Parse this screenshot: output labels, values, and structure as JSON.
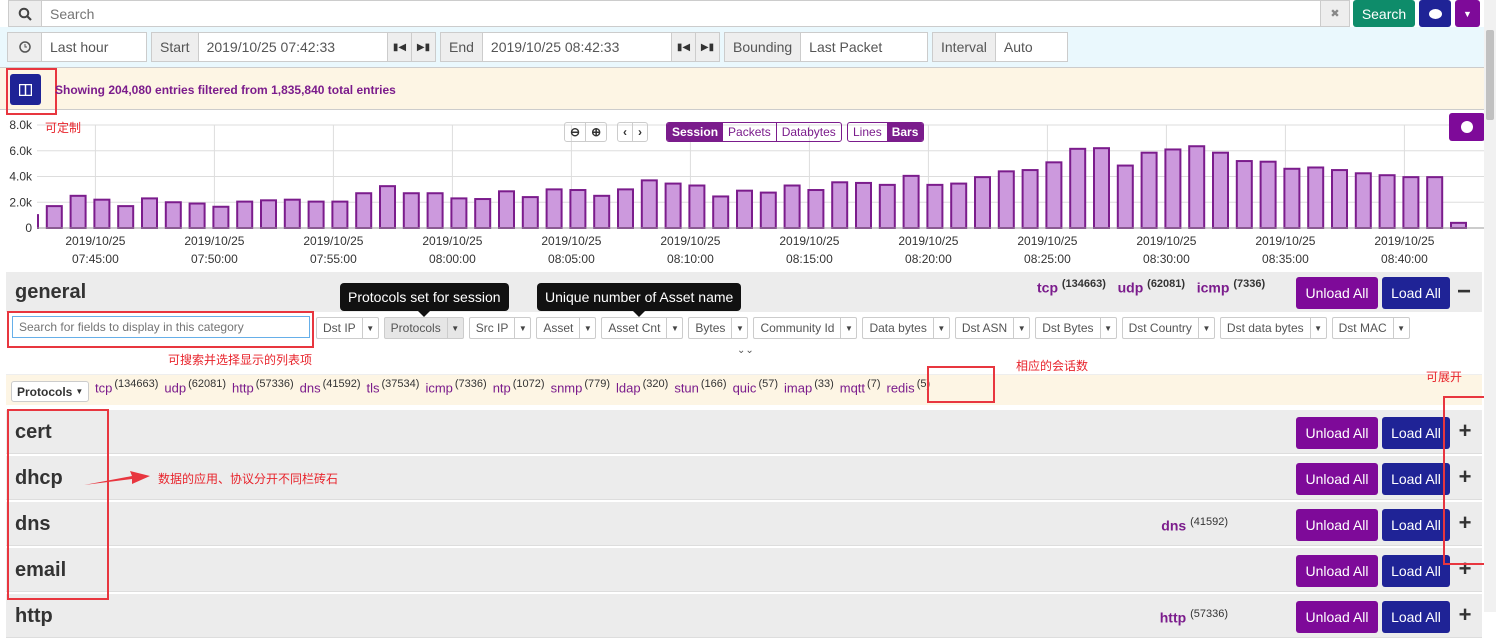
{
  "search": {
    "placeholder": "Search",
    "search_label": "Search",
    "clear": "✖"
  },
  "time": {
    "range": "Last hour",
    "start_label": "Start",
    "start": "2019/10/25 07:42:33",
    "end_label": "End",
    "end": "2019/10/25 08:42:33",
    "bounding_label": "Bounding",
    "bounding": "Last Packet",
    "interval_label": "Interval",
    "interval": "Auto"
  },
  "notice": "Showing 204,080 entries filtered from 1,835,840 total entries",
  "chart_controls": {
    "metrics": [
      "Session",
      "Packets",
      "Databytes"
    ],
    "active_metric": "Session",
    "styles": [
      "Lines",
      "Bars"
    ],
    "active_style": "Bars"
  },
  "colors": {
    "bar_fill": "#cc99dd",
    "bar_stroke": "#7b1c8c",
    "accent_purple": "#7e0a99",
    "navy": "#1f2396",
    "search_green": "#0e8c6a",
    "notice_bg": "#fdf5e4"
  },
  "chart_data": {
    "type": "bar",
    "title": "",
    "xlabel": "",
    "ylabel": "",
    "ylim": [
      0,
      8000
    ],
    "yticks": [
      "0",
      "2.0k",
      "4.0k",
      "6.0k",
      "8.0k"
    ],
    "xticks": [
      {
        "date": "2019/10/25",
        "time": "07:45:00"
      },
      {
        "date": "2019/10/25",
        "time": "07:50:00"
      },
      {
        "date": "2019/10/25",
        "time": "07:55:00"
      },
      {
        "date": "2019/10/25",
        "time": "08:00:00"
      },
      {
        "date": "2019/10/25",
        "time": "08:05:00"
      },
      {
        "date": "2019/10/25",
        "time": "08:10:00"
      },
      {
        "date": "2019/10/25",
        "time": "08:15:00"
      },
      {
        "date": "2019/10/25",
        "time": "08:20:00"
      },
      {
        "date": "2019/10/25",
        "time": "08:25:00"
      },
      {
        "date": "2019/10/25",
        "time": "08:30:00"
      },
      {
        "date": "2019/10/25",
        "time": "08:35:00"
      },
      {
        "date": "2019/10/25",
        "time": "08:40:00"
      }
    ],
    "grid": true,
    "categories": [
      "07:42",
      "07:43",
      "07:44",
      "07:45",
      "07:46",
      "07:47",
      "07:48",
      "07:49",
      "07:50",
      "07:51",
      "07:52",
      "07:53",
      "07:54",
      "07:55",
      "07:56",
      "07:57",
      "07:58",
      "07:59",
      "08:00",
      "08:01",
      "08:02",
      "08:03",
      "08:04",
      "08:05",
      "08:06",
      "08:07",
      "08:08",
      "08:09",
      "08:10",
      "08:11",
      "08:12",
      "08:13",
      "08:14",
      "08:15",
      "08:16",
      "08:17",
      "08:18",
      "08:19",
      "08:20",
      "08:21",
      "08:22",
      "08:23",
      "08:24",
      "08:25",
      "08:26",
      "08:27",
      "08:28",
      "08:29",
      "08:30",
      "08:31",
      "08:32",
      "08:33",
      "08:34",
      "08:35",
      "08:36",
      "08:37",
      "08:38",
      "08:39",
      "08:40",
      "08:41",
      "08:42"
    ],
    "values": [
      1000,
      1700,
      2500,
      2200,
      1700,
      2300,
      2000,
      1900,
      1650,
      2050,
      2150,
      2200,
      2050,
      2050,
      2700,
      3250,
      2700,
      2700,
      2300,
      2250,
      2850,
      2400,
      3000,
      2950,
      2500,
      3000,
      3700,
      3450,
      3300,
      2450,
      2900,
      2750,
      3300,
      2950,
      3550,
      3500,
      3350,
      4050,
      3350,
      3450,
      3950,
      4400,
      4500,
      5100,
      6150,
      6200,
      4850,
      5850,
      6100,
      6350,
      5850,
      5200,
      5150,
      4600,
      4700,
      4500,
      4250,
      4100,
      3950,
      3950,
      400
    ]
  },
  "general": {
    "title": "general",
    "header_counts": [
      {
        "name": "tcp",
        "count": "(134663)"
      },
      {
        "name": "udp",
        "count": "(62081)"
      },
      {
        "name": "icmp",
        "count": "(7336)"
      }
    ],
    "field_search_placeholder": "Search for fields to display in this category",
    "fields": [
      "Dst IP",
      "Protocols",
      "Src IP",
      "Asset",
      "Asset Cnt",
      "Bytes",
      "Community Id",
      "Data bytes",
      "Dst ASN",
      "Dst Bytes",
      "Dst Country",
      "Dst data bytes",
      "Dst MAC"
    ],
    "tooltips": [
      "Protocols set for session",
      "Unique number of Asset name"
    ],
    "protocols_label": "Protocols",
    "protocols": [
      {
        "name": "tcp",
        "count": "(134663)"
      },
      {
        "name": "udp",
        "count": "(62081)"
      },
      {
        "name": "http",
        "count": "(57336)"
      },
      {
        "name": "dns",
        "count": "(41592)"
      },
      {
        "name": "tls",
        "count": "(37534)"
      },
      {
        "name": "icmp",
        "count": "(7336)"
      },
      {
        "name": "ntp",
        "count": "(1072)"
      },
      {
        "name": "snmp",
        "count": "(779)"
      },
      {
        "name": "ldap",
        "count": "(320)"
      },
      {
        "name": "stun",
        "count": "(166)"
      },
      {
        "name": "quic",
        "count": "(57)"
      },
      {
        "name": "imap",
        "count": "(33)"
      },
      {
        "name": "mqtt",
        "count": "(7)"
      },
      {
        "name": "redis",
        "count": "(5)"
      }
    ]
  },
  "sections": [
    {
      "title": "cert",
      "tag": "",
      "count": ""
    },
    {
      "title": "dhcp",
      "tag": "",
      "count": ""
    },
    {
      "title": "dns",
      "tag": "dns",
      "count": "(41592)"
    },
    {
      "title": "email",
      "tag": "",
      "count": ""
    },
    {
      "title": "http",
      "tag": "http",
      "count": "(57336)"
    }
  ],
  "buttons": {
    "unload_all": "Unload All",
    "load_all": "Load All",
    "collapse": "−",
    "expand": "+"
  },
  "annotations": {
    "customizable": "可定制",
    "searchable": "可搜索并选择显示的列表项",
    "session_count": "相应的会话数",
    "expandable": "可展开",
    "categories": "数据的应用、协议分开不同栏砖石"
  }
}
